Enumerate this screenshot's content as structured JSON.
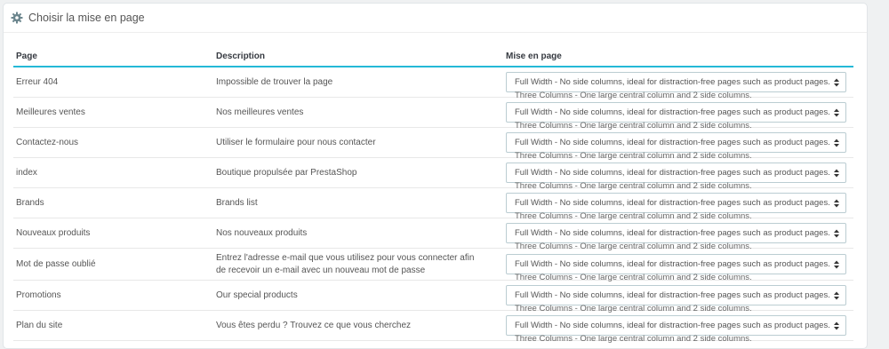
{
  "panel": {
    "title": "Choisir la mise en page",
    "icon": "gear-icon"
  },
  "table": {
    "headers": {
      "page": "Page",
      "description": "Description",
      "layout": "Mise en page"
    },
    "layout_options": [
      "Full Width - No side columns, ideal for distraction-free pages such as product pages.",
      "Three Columns - One large central column and 2 side columns."
    ],
    "rows": [
      {
        "page": "Erreur 404",
        "description": "Impossible de trouver la page"
      },
      {
        "page": "Meilleures ventes",
        "description": "Nos meilleures ventes"
      },
      {
        "page": "Contactez-nous",
        "description": "Utiliser le formulaire pour nous contacter"
      },
      {
        "page": "index",
        "description": "Boutique propulsée par PrestaShop"
      },
      {
        "page": "Brands",
        "description": "Brands list"
      },
      {
        "page": "Nouveaux produits",
        "description": "Nos nouveaux produits"
      },
      {
        "page": "Mot de passe oublié",
        "description": "Entrez l'adresse e-mail que vous utilisez pour vous connecter afin de recevoir un e-mail avec un nouveau mot de passe"
      },
      {
        "page": "Promotions",
        "description": "Our special products"
      },
      {
        "page": "Plan du site",
        "description": "Vous êtes perdu ? Trouvez ce que vous cherchez"
      }
    ]
  },
  "colors": {
    "header_border": "#25b9d7",
    "select_border": "#bbcdd2",
    "background": "#eff1f2"
  }
}
